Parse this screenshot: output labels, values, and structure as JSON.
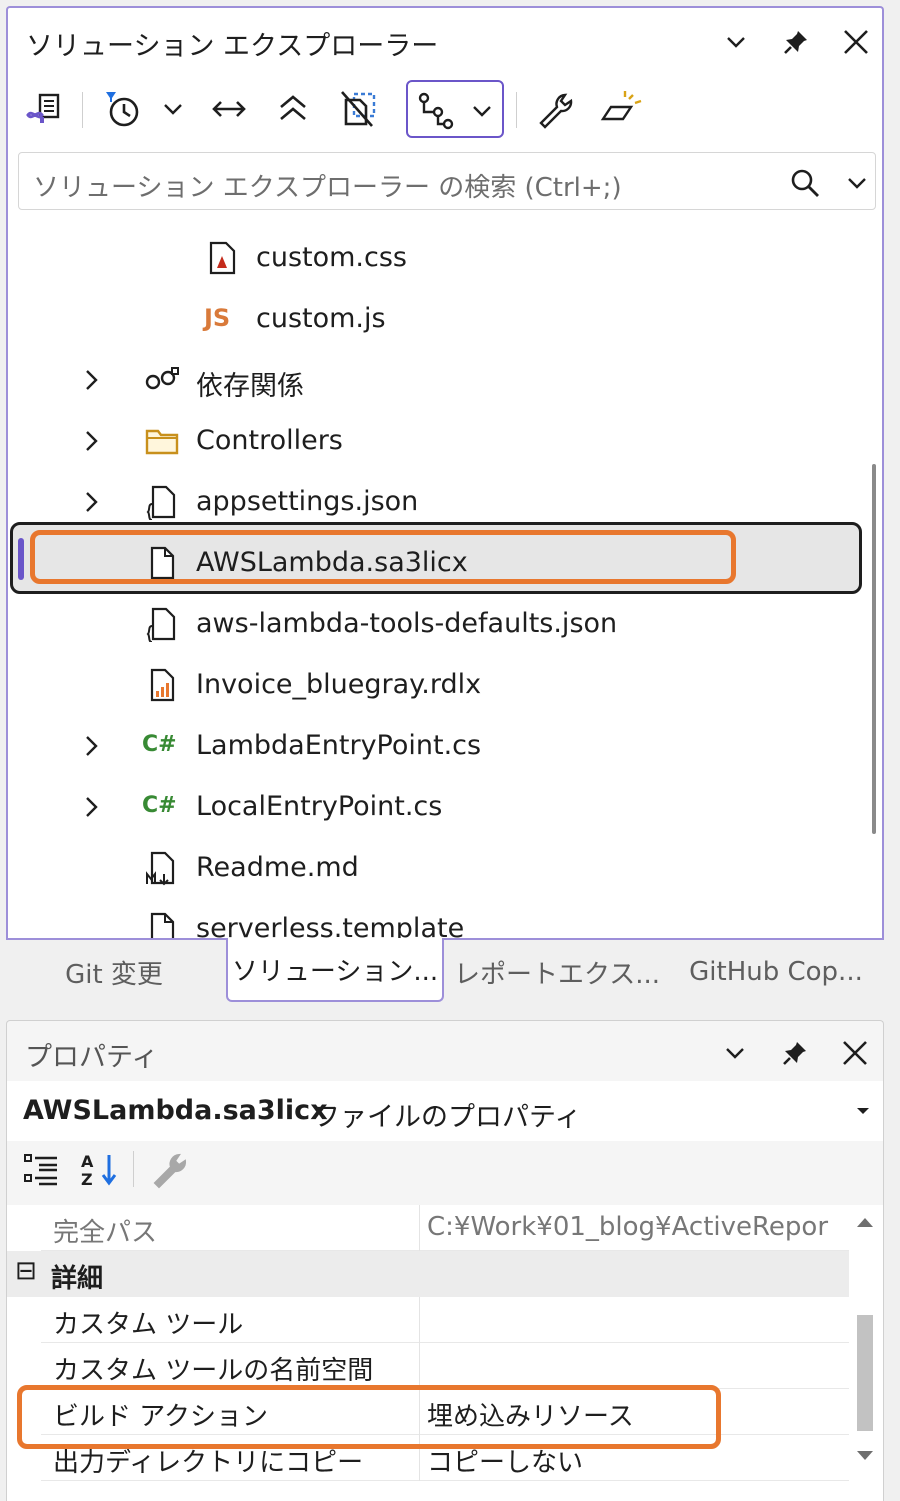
{
  "solution_explorer": {
    "title": "ソリューション エクスプローラー",
    "search_placeholder": "ソリューション エクスプローラー の検索 (Ctrl+;)",
    "tree_items": [
      {
        "label": "custom.css",
        "icon": "css-file-icon",
        "expandable": false
      },
      {
        "label": "custom.js",
        "icon": "js-file-icon",
        "icon_text": "JS",
        "expandable": false
      },
      {
        "label": "依存関係",
        "icon": "dependencies-icon",
        "expandable": true
      },
      {
        "label": "Controllers",
        "icon": "folder-icon",
        "expandable": true
      },
      {
        "label": "appsettings.json",
        "icon": "json-file-icon",
        "expandable": true
      },
      {
        "label": "AWSLambda.sa3licx",
        "icon": "file-icon",
        "expandable": false,
        "selected": true
      },
      {
        "label": "aws-lambda-tools-defaults.json",
        "icon": "json-file-icon",
        "expandable": false
      },
      {
        "label": "Invoice_bluegray.rdlx",
        "icon": "report-file-icon",
        "expandable": false
      },
      {
        "label": "LambdaEntryPoint.cs",
        "icon": "csharp-file-icon",
        "icon_text": "C#",
        "expandable": true
      },
      {
        "label": "LocalEntryPoint.cs",
        "icon": "csharp-file-icon",
        "icon_text": "C#",
        "expandable": true
      },
      {
        "label": "Readme.md",
        "icon": "markdown-file-icon",
        "expandable": false
      },
      {
        "label": "serverless.template",
        "icon": "file-icon",
        "expandable": false
      }
    ]
  },
  "tabs": [
    {
      "label": "Git 変更",
      "active": false
    },
    {
      "label": "ソリューション...",
      "active": true
    },
    {
      "label": "レポートエクス...",
      "active": false
    },
    {
      "label": "GitHub Cop...",
      "active": false
    }
  ],
  "properties": {
    "title": "プロパティ",
    "object_name": "AWSLambda.sa3licx",
    "object_type": "ファイルのプロパティ",
    "rows": [
      {
        "name": "完全パス",
        "value": "C:¥Work¥01_blog¥ActiveRepor",
        "dimmed": true
      },
      {
        "category": "詳細",
        "collapse_glyph": "⊟"
      },
      {
        "name": "カスタム ツール",
        "value": ""
      },
      {
        "name": "カスタム ツールの名前空間",
        "value": ""
      },
      {
        "name": "ビルド アクション",
        "value": "埋め込みリソース",
        "highlighted": true
      },
      {
        "name": "出力ディレクトリにコピー",
        "value": "コピーしない"
      }
    ]
  },
  "colors": {
    "accent": "#6b56c9",
    "highlight": "#e8772e",
    "csharp": "#388a34",
    "js": "#d97a3a"
  }
}
